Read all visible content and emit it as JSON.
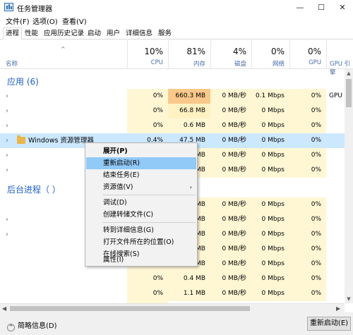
{
  "window": {
    "title": "任务管理器",
    "minimize": "—",
    "maximize": "☐",
    "close": "✕"
  },
  "menu": [
    "文件(F)",
    "选项(O)",
    "查看(V)"
  ],
  "tabs": [
    "进程",
    "性能",
    "应用历史记录",
    "启动",
    "用户",
    "详细信息",
    "服务"
  ],
  "header": {
    "name_label": "名称",
    "cpu": {
      "pct": "10%",
      "label": "CPU"
    },
    "mem": {
      "pct": "81%",
      "label": "内存"
    },
    "disk": {
      "pct": "4%",
      "label": "磁盘"
    },
    "net": {
      "pct": "0%",
      "label": "网络"
    },
    "gpu": {
      "pct": "0%",
      "label": "GPU"
    },
    "gpu_engine": {
      "label": "GPU 引擎"
    }
  },
  "groups": {
    "apps": "应用 (6)",
    "background": "后台进程（  ）"
  },
  "rows": [
    {
      "cpu": "0%",
      "mem": "660.3 MB",
      "disk": "0 MB/秒",
      "net": "0.1 Mbps",
      "gpu": "0%",
      "engine": "GPU"
    },
    {
      "cpu": "0%",
      "mem": "66.8 MB",
      "disk": "0 MB/秒",
      "net": "0 Mbps",
      "gpu": "0%",
      "engine": ""
    },
    {
      "cpu": "0%",
      "mem": "0.6 MB",
      "disk": "0 MB/秒",
      "net": "0 Mbps",
      "gpu": "0%",
      "engine": ""
    },
    {
      "name": "Windows 资源管理器",
      "cpu": "0.4%",
      "mem": "47.5 MB",
      "disk": "0 MB/秒",
      "net": "0 Mbps",
      "gpu": "0%",
      "engine": ""
    },
    {
      "cpu": "",
      "mem": "MB",
      "disk": "0 MB/秒",
      "net": "0 Mbps",
      "gpu": "0%",
      "engine": ""
    },
    {
      "cpu": "",
      "mem": "MB",
      "disk": "0 MB/秒",
      "net": "0 Mbps",
      "gpu": "0%",
      "engine": ""
    },
    {
      "cpu": "",
      "mem": "MB",
      "disk": "0 MB/秒",
      "net": "0 Mbps",
      "gpu": "0%",
      "engine": ""
    },
    {
      "cpu": "",
      "mem": "MB",
      "disk": "0 MB/秒",
      "net": "0 Mbps",
      "gpu": "0%",
      "engine": ""
    },
    {
      "cpu": "",
      "mem": "MB",
      "disk": "0 MB/秒",
      "net": "0 Mbps",
      "gpu": "0%",
      "engine": ""
    },
    {
      "cpu": "",
      "mem": "MB",
      "disk": "0 MB/秒",
      "net": "0 Mbps",
      "gpu": "0%",
      "engine": ""
    },
    {
      "cpu": "",
      "mem": "MB",
      "disk": "0 MB/秒",
      "net": "0 Mbps",
      "gpu": "0%",
      "engine": ""
    },
    {
      "cpu": "",
      "mem": "MB",
      "disk": "0 MB/秒",
      "net": "0 Mbps",
      "gpu": "0%",
      "engine": ""
    },
    {
      "cpu": "0%",
      "mem": "0.4 MB",
      "disk": "0 MB/秒",
      "net": "0 Mbps",
      "gpu": "0%",
      "engine": ""
    },
    {
      "cpu": "0%",
      "mem": "1.1 MB",
      "disk": "0 MB/秒",
      "net": "0 Mbps",
      "gpu": "0%",
      "engine": ""
    },
    {
      "cpu": "0%",
      "mem": "",
      "disk": "",
      "net": "",
      "gpu": "",
      "engine": ""
    }
  ],
  "context_menu": {
    "items": [
      "展开(P)",
      "重新启动(R)",
      "结束任务(E)",
      "资源值(V)",
      "调试(D)",
      "创建转储文件(C)",
      "转到详细信息(G)",
      "打开文件所在的位置(O)",
      "在线搜索(S)",
      "属性(I)"
    ],
    "submenu_arrow": "›"
  },
  "footer": {
    "less_details": "简略信息(D)",
    "restart_button": "重新启动(E)"
  }
}
